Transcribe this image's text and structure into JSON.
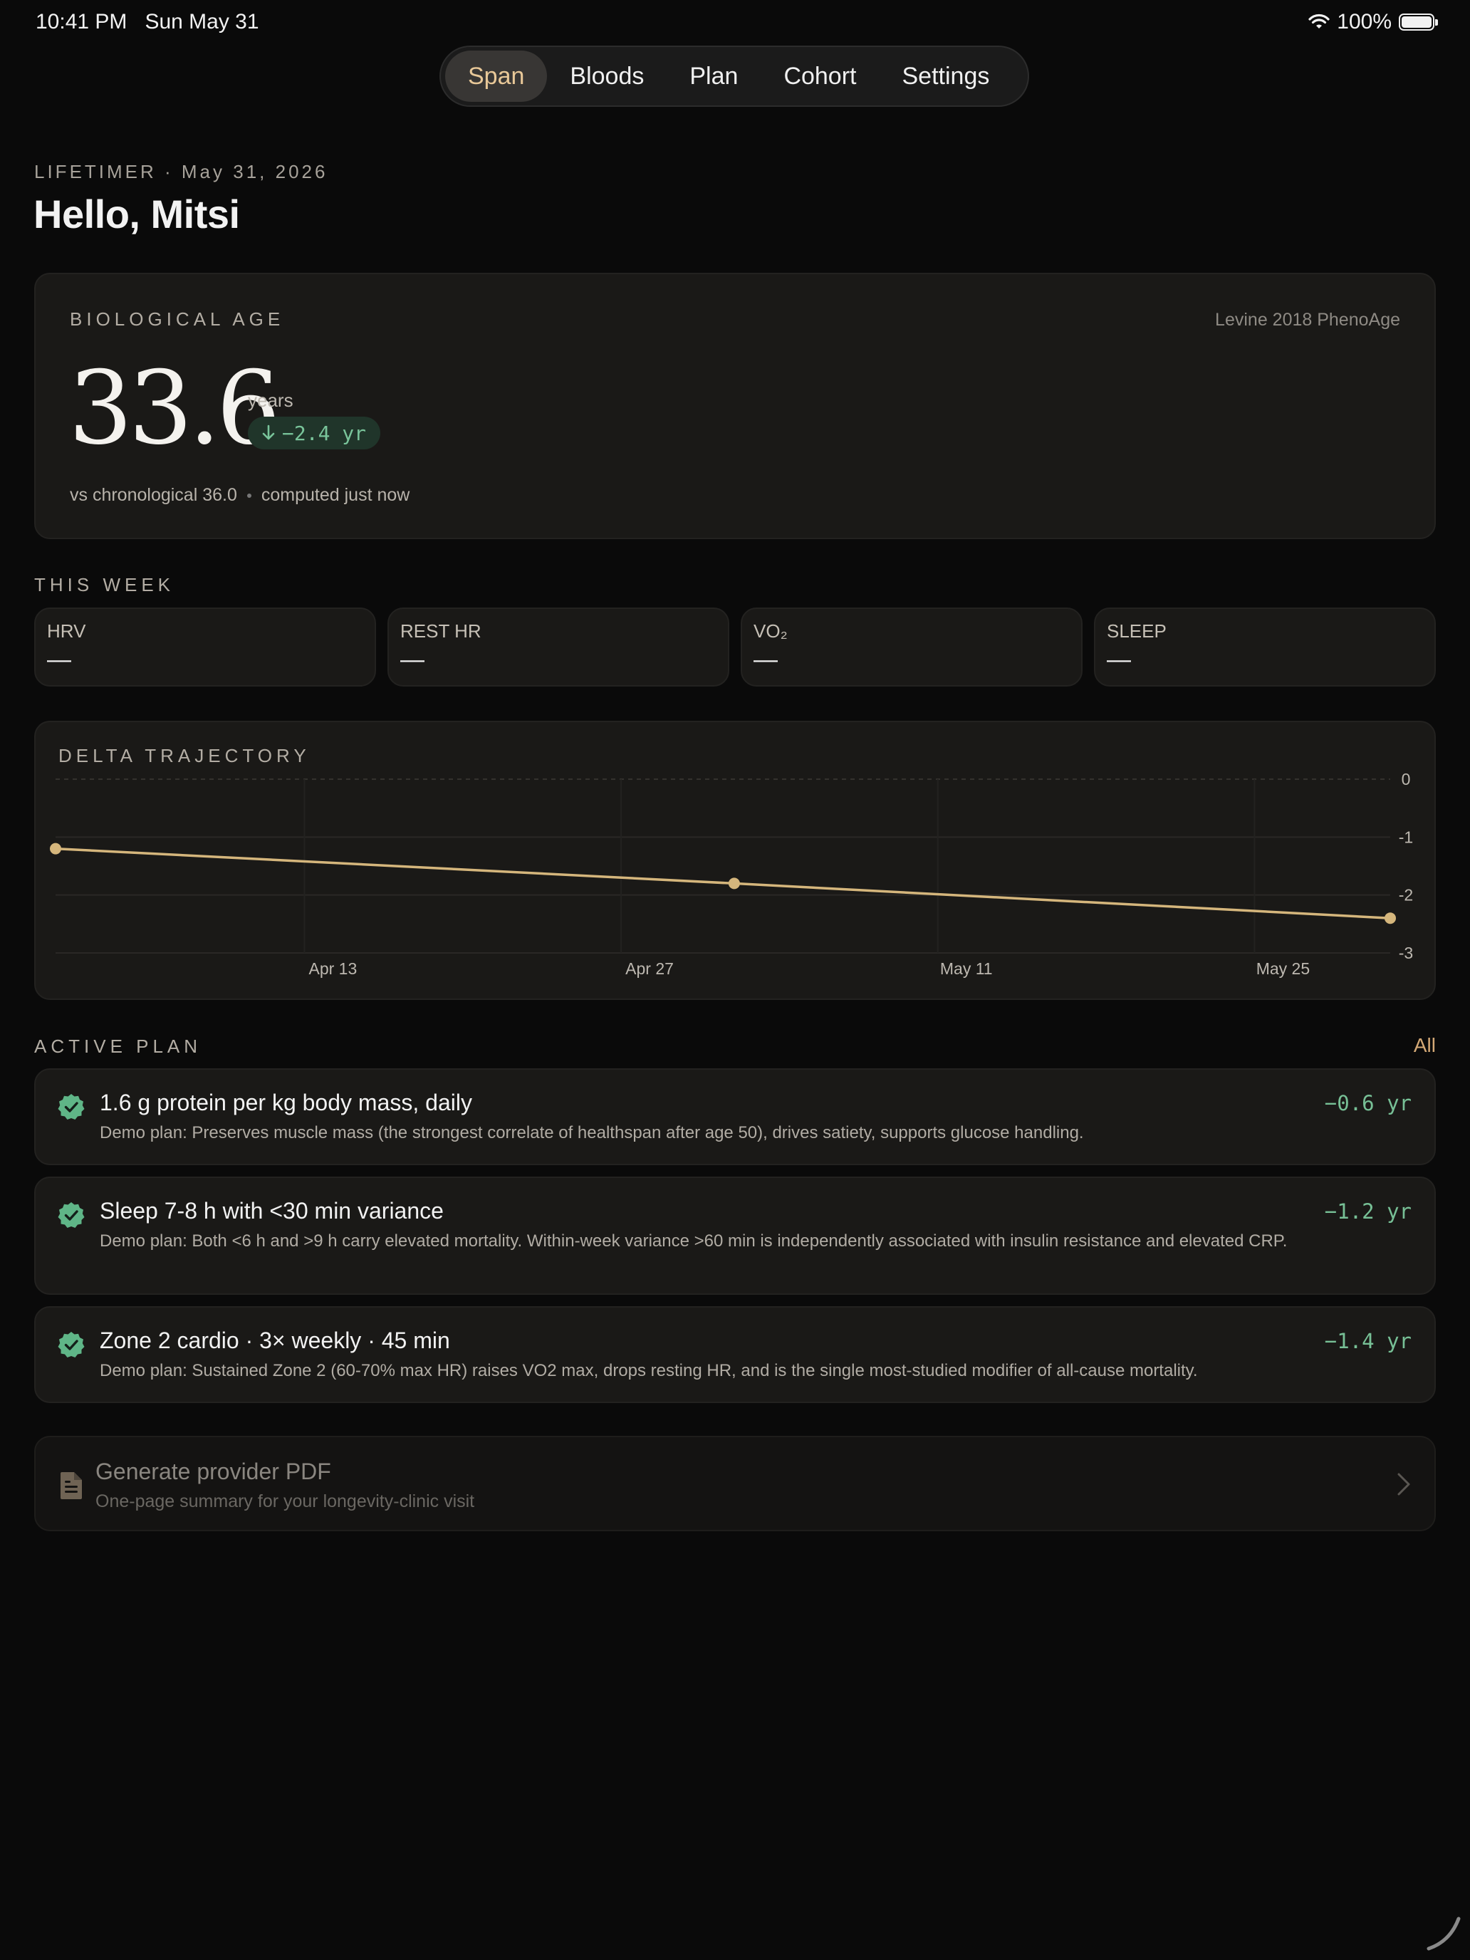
{
  "status_bar": {
    "time": "10:41 PM",
    "date": "Sun May 31",
    "battery": "100%"
  },
  "tabs": [
    {
      "label": "Span",
      "active": true
    },
    {
      "label": "Bloods",
      "active": false
    },
    {
      "label": "Plan",
      "active": false
    },
    {
      "label": "Cohort",
      "active": false
    },
    {
      "label": "Settings",
      "active": false
    }
  ],
  "header": {
    "eyebrow": "LIFETIMER · May 31, 2026",
    "greeting": "Hello, Mitsi"
  },
  "bio_age": {
    "label": "BIOLOGICAL AGE",
    "method": "Levine 2018 PhenoAge",
    "value": "33.6",
    "unit": "years",
    "delta": "−2.4 yr",
    "vs_chrono": "vs chronological 36.0",
    "computed": "computed just now"
  },
  "this_week": {
    "label": "THIS WEEK",
    "metrics": [
      {
        "label": "HRV",
        "value": "—"
      },
      {
        "label": "REST HR",
        "value": "—"
      },
      {
        "label": "VO₂",
        "value": "—"
      },
      {
        "label": "SLEEP",
        "value": "—"
      }
    ]
  },
  "chart_data": {
    "type": "line",
    "title": "DELTA TRAJECTORY",
    "x_ticks": [
      "Apr 13",
      "Apr 27",
      "May 11",
      "May 25"
    ],
    "y_ticks": [
      "0",
      "-1",
      "-2",
      "-3"
    ],
    "ylim": [
      -3,
      0
    ],
    "xlim": [
      "2026-04-02",
      "2026-05-31"
    ],
    "grid": true,
    "series": [
      {
        "x": [
          "2026-04-02",
          "2026-05-02",
          "2026-05-31"
        ],
        "y": [
          -1.2,
          -1.8,
          -2.4
        ],
        "color": "#d5b67c"
      }
    ]
  },
  "active_plan": {
    "label": "ACTIVE PLAN",
    "all_label": "All",
    "items": [
      {
        "title": "1.6 g protein per kg body mass, daily",
        "desc": "Demo plan: Preserves muscle mass (the strongest correlate of healthspan after age 50), drives satiety, supports glucose handling.",
        "delta": "−0.6 yr"
      },
      {
        "title": "Sleep 7-8 h with <30 min variance",
        "desc": "Demo plan: Both <6 h and >9 h carry elevated mortality. Within-week variance >60 min is independently associated with insulin resistance and elevated CRP.",
        "delta": "−1.2 yr"
      },
      {
        "title": "Zone 2 cardio · 3× weekly · 45 min",
        "desc": "Demo plan: Sustained Zone 2 (60-70% max HR) raises VO2 max, drops resting HR, and is the single most-studied modifier of all-cause mortality.",
        "delta": "−1.4 yr"
      }
    ]
  },
  "pdf": {
    "title": "Generate provider PDF",
    "subtitle": "One-page summary for your longevity-clinic visit"
  },
  "colors": {
    "accent": "#d4a976",
    "positive": "#77c096",
    "background": "#0a0a0a",
    "card": "#1a1917"
  }
}
